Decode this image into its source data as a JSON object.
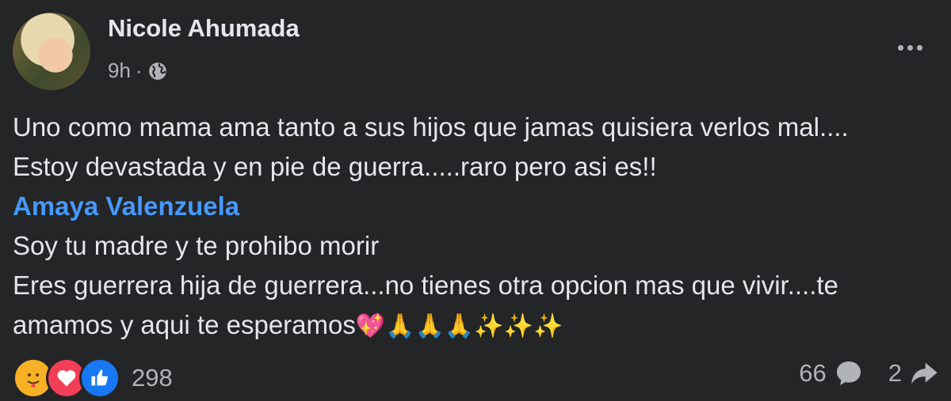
{
  "post": {
    "author": "Nicole Ahumada",
    "time": "9h",
    "separator": "·",
    "audience_icon": "globe-icon",
    "more_icon": "more-options-icon",
    "lines": [
      "Uno como mama ama tanto a sus hijos que jamas quisiera verlos mal....",
      "Estoy devastada y en pie de guerra.....raro pero asi es!!"
    ],
    "mention": "Amaya Valenzuela",
    "lines_after": [
      "Soy tu madre y te prohibo morir",
      "Eres guerrera hija de guerrera...no tienes otra opcion mas que vivir....te"
    ],
    "last_line_text": "amamos y aqui te esperamos",
    "last_line_emojis": "💖🙏🙏🙏✨✨✨"
  },
  "footer": {
    "reactions": [
      "care-reaction-icon",
      "love-reaction-icon",
      "like-reaction-icon"
    ],
    "reaction_count": "298",
    "comments_count": "66",
    "shares_count": "2"
  },
  "colors": {
    "background": "#242526",
    "text": "#e4e6eb",
    "secondary": "#b0b3b8",
    "mention": "#4599ff"
  }
}
